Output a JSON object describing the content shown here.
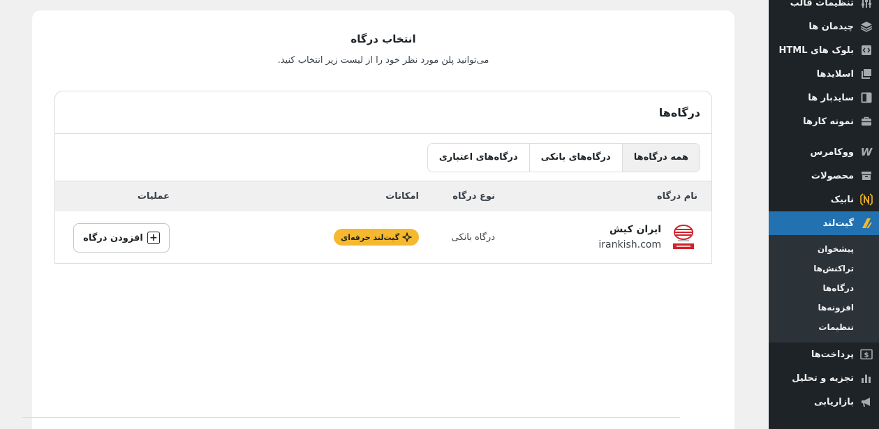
{
  "sidebar": {
    "items_top": [
      {
        "label": "تنظیمات قالب",
        "icon": "sliders-icon"
      },
      {
        "label": "چیدمان ها",
        "icon": "layers-icon"
      },
      {
        "label": "بلوک های HTML",
        "icon": "code-block-icon"
      },
      {
        "label": "اسلایدها",
        "icon": "slides-icon"
      },
      {
        "label": "سایدبار ها",
        "icon": "sidebar-icon"
      },
      {
        "label": "نمونه کارها",
        "icon": "briefcase-icon"
      }
    ],
    "items_mid": [
      {
        "label": "ووکامرس",
        "icon": "woocommerce-icon"
      },
      {
        "label": "محصولات",
        "icon": "archive-icon"
      },
      {
        "label": "نابیک",
        "icon": "nabik-icon"
      },
      {
        "label": "گیت‌لند",
        "icon": "gateland-icon"
      }
    ],
    "submenu": [
      "پیشخوان",
      "تراکنش‌ها",
      "درگاه‌ها",
      "افزونه‌ها",
      "تنظیمات"
    ],
    "items_bottom": [
      {
        "label": "پرداخت‌ها",
        "icon": "dollar-icon"
      },
      {
        "label": "تجزیه و تحلیل",
        "icon": "chart-bars-icon"
      },
      {
        "label": "بازاریابی",
        "icon": "megaphone-icon"
      }
    ]
  },
  "header": {
    "title": "انتخاب درگاه",
    "subtitle": "می‌توانید پلن مورد نظر خود را از لیست زیر انتخاب کنید."
  },
  "gateways_box": {
    "title": "درگاه‌ها",
    "tabs": [
      "همه درگاه‌ها",
      "درگاه‌های بانکی",
      "درگاه‌های اعتباری"
    ],
    "columns": {
      "name": "نام درگاه",
      "type": "نوع درگاه",
      "features": "امکانات",
      "actions": "عملیات"
    },
    "rows": [
      {
        "name": "ایران کیش",
        "domain": "irankish.com",
        "type": "درگاه بانکی",
        "badge": "گیت‌لند حرفه‌ای",
        "action": "افزودن درگاه"
      }
    ]
  },
  "colors": {
    "sidebar_bg": "#1d2327",
    "active": "#2271b1",
    "badge": "#f5b82e",
    "logo_red": "#d6202a"
  }
}
